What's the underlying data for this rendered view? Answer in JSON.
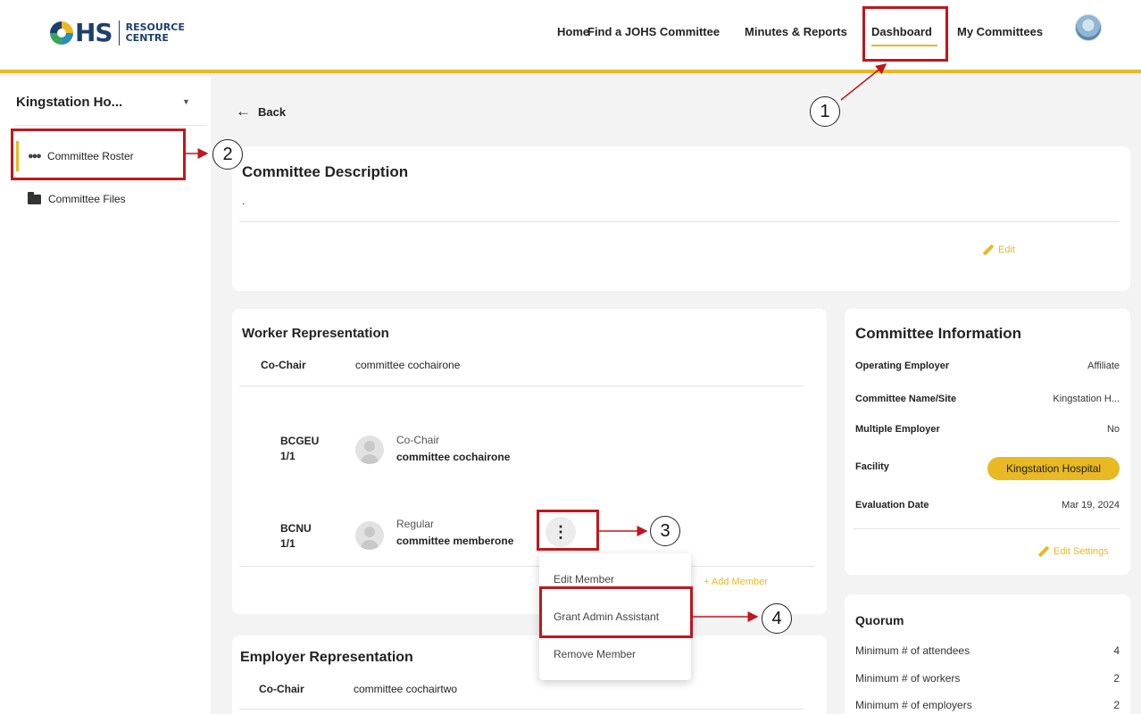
{
  "header": {
    "logo_letters": "HS",
    "logo_text_line1": "RESOURCE",
    "logo_text_line2": "CENTRE",
    "nav": [
      "Home",
      "Find a JOHS Committee",
      "Minutes & Reports",
      "Dashboard",
      "My Committees"
    ],
    "active_nav": "Dashboard"
  },
  "sidebar": {
    "committee_select": "Kingstation Ho...",
    "items": [
      {
        "label": "Committee Roster",
        "icon": "people-icon",
        "active": true
      },
      {
        "label": "Committee Files",
        "icon": "folder-icon",
        "active": false
      }
    ]
  },
  "main": {
    "back_label": "Back",
    "description_card": {
      "title": "Committee Description",
      "text": ".",
      "edit_label": "Edit"
    },
    "worker_card": {
      "title": "Worker Representation",
      "cochair_label": "Co-Chair",
      "cochair_name": "committee cochairone",
      "members": [
        {
          "union": "BCGEU",
          "count": "1/1",
          "role": "Co-Chair",
          "name": "committee cochairone"
        },
        {
          "union": "BCNU",
          "count": "1/1",
          "role": "Regular",
          "name": "committee memberone"
        }
      ],
      "add_member_label": "+ Add Member"
    },
    "member_menu": {
      "items": [
        "Edit Member",
        "Grant Admin Assistant",
        "Remove Member"
      ]
    },
    "employer_card": {
      "title": "Employer Representation",
      "cochair_label": "Co-Chair",
      "cochair_name": "committee cochairtwo"
    },
    "info_card": {
      "title": "Committee Information",
      "rows": [
        {
          "label": "Operating Employer",
          "value": "Affiliate"
        },
        {
          "label": "Committee Name/Site",
          "value": "Kingstation H..."
        },
        {
          "label": "Multiple Employer",
          "value": "No"
        },
        {
          "label": "Facility",
          "value": "Kingstation Hospital"
        },
        {
          "label": "Evaluation Date",
          "value": "Mar 19, 2024"
        }
      ],
      "edit_settings_label": "Edit Settings"
    },
    "quorum_card": {
      "title": "Quorum",
      "rows": [
        {
          "label": "Minimum # of attendees",
          "value": "4"
        },
        {
          "label": "Minimum # of workers",
          "value": "2"
        },
        {
          "label": "Minimum # of employers",
          "value": "2"
        }
      ]
    }
  },
  "annotations": [
    "1",
    "2",
    "3",
    "4"
  ],
  "colors": {
    "accent": "#e8b923",
    "annotation": "#c0161c",
    "brand": "#1c3f6e"
  }
}
